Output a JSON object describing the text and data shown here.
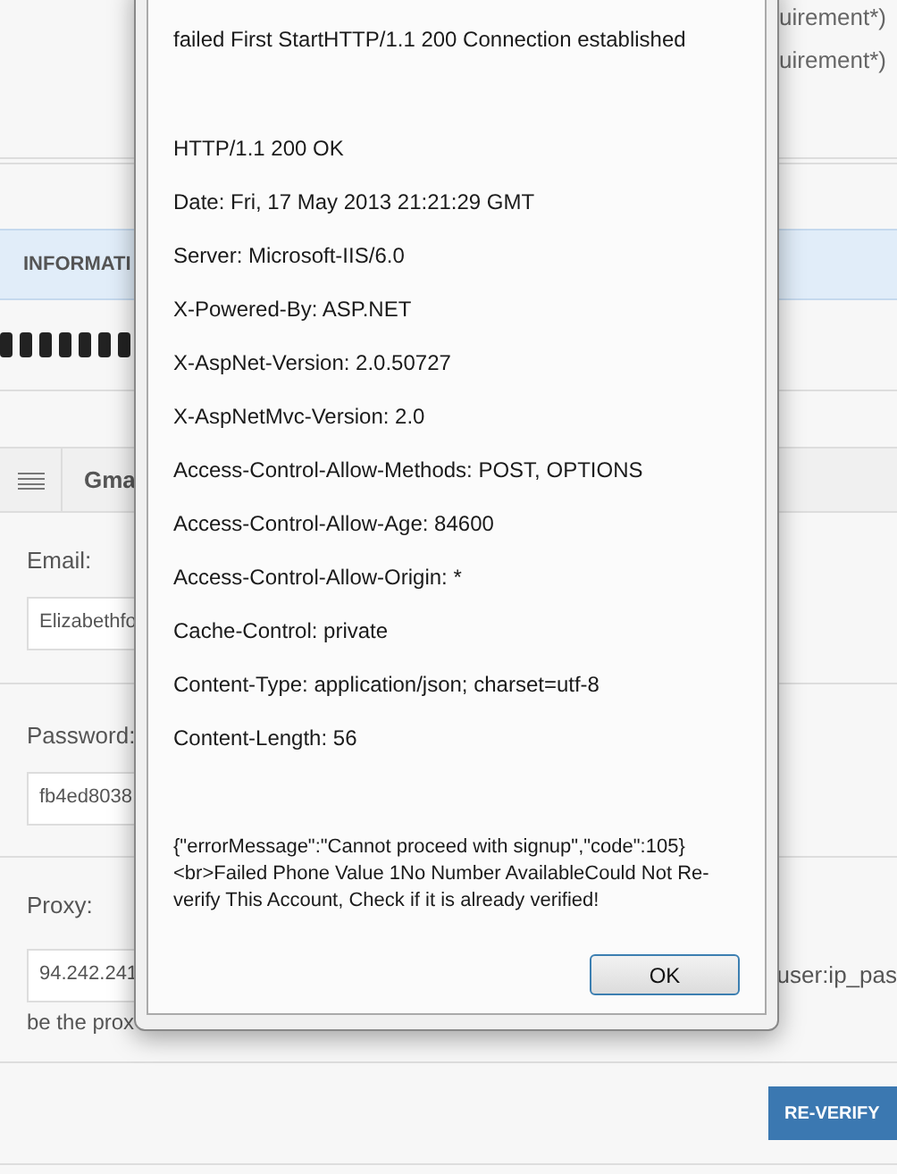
{
  "page": {
    "notes": [
      "uirement*)",
      "uirement*)"
    ],
    "info_heading": "INFORMATI",
    "panel_tab": "Gma",
    "fields": [
      {
        "label": "Email:",
        "value": "Elizabethfo"
      },
      {
        "label": "Password:",
        "value": "fb4ed8038"
      },
      {
        "label": "Proxy:",
        "value": "94.242.241",
        "note_right": "user:ip_pas",
        "note_below": "be the prox"
      }
    ],
    "button": "RE-VERIFY"
  },
  "dialog": {
    "status": "failed First StartHTTP/1.1 200 Connection established",
    "headers": [
      "HTTP/1.1 200 OK",
      "Date: Fri, 17 May 2013 21:21:29 GMT",
      "Server: Microsoft-IIS/6.0",
      "X-Powered-By: ASP.NET",
      "X-AspNet-Version: 2.0.50727",
      "X-AspNetMvc-Version: 2.0",
      "Access-Control-Allow-Methods: POST, OPTIONS",
      "Access-Control-Allow-Age: 84600",
      "Access-Control-Allow-Origin: *",
      "Cache-Control: private",
      "Content-Type: application/json; charset=utf-8",
      "Content-Length: 56"
    ],
    "message": "{\"errorMessage\":\"Cannot proceed with signup\",\"code\":105}<br>Failed Phone Value 1No Number AvailableCould Not Re-verify This Account, Check if it is already verified!",
    "button": "OK"
  }
}
